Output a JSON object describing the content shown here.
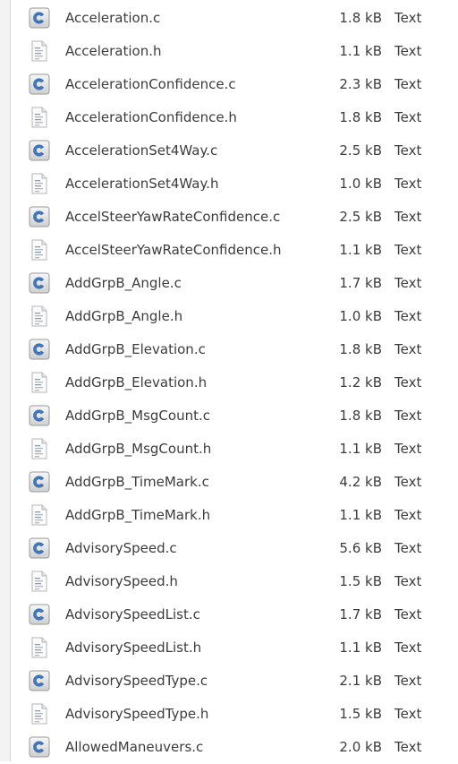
{
  "icons": {
    "c_source": "c-source-file-icon",
    "c_header": "c-header-file-icon"
  },
  "colors": {
    "text": "#3c3c3c",
    "c_icon_blue": "#3f7cc4",
    "header_icon_line": "#7da0c8"
  },
  "files": [
    {
      "name": "Acceleration.c",
      "size": "1.8 kB",
      "type": "Text",
      "kind": "c"
    },
    {
      "name": "Acceleration.h",
      "size": "1.1 kB",
      "type": "Text",
      "kind": "h"
    },
    {
      "name": "AccelerationConfidence.c",
      "size": "2.3 kB",
      "type": "Text",
      "kind": "c"
    },
    {
      "name": "AccelerationConfidence.h",
      "size": "1.8 kB",
      "type": "Text",
      "kind": "h"
    },
    {
      "name": "AccelerationSet4Way.c",
      "size": "2.5 kB",
      "type": "Text",
      "kind": "c"
    },
    {
      "name": "AccelerationSet4Way.h",
      "size": "1.0 kB",
      "type": "Text",
      "kind": "h"
    },
    {
      "name": "AccelSteerYawRateConfidence.c",
      "size": "2.5 kB",
      "type": "Text",
      "kind": "c"
    },
    {
      "name": "AccelSteerYawRateConfidence.h",
      "size": "1.1 kB",
      "type": "Text",
      "kind": "h"
    },
    {
      "name": "AddGrpB_Angle.c",
      "size": "1.7 kB",
      "type": "Text",
      "kind": "c"
    },
    {
      "name": "AddGrpB_Angle.h",
      "size": "1.0 kB",
      "type": "Text",
      "kind": "h"
    },
    {
      "name": "AddGrpB_Elevation.c",
      "size": "1.8 kB",
      "type": "Text",
      "kind": "c"
    },
    {
      "name": "AddGrpB_Elevation.h",
      "size": "1.2 kB",
      "type": "Text",
      "kind": "h"
    },
    {
      "name": "AddGrpB_MsgCount.c",
      "size": "1.8 kB",
      "type": "Text",
      "kind": "c"
    },
    {
      "name": "AddGrpB_MsgCount.h",
      "size": "1.1 kB",
      "type": "Text",
      "kind": "h"
    },
    {
      "name": "AddGrpB_TimeMark.c",
      "size": "4.2 kB",
      "type": "Text",
      "kind": "c"
    },
    {
      "name": "AddGrpB_TimeMark.h",
      "size": "1.1 kB",
      "type": "Text",
      "kind": "h"
    },
    {
      "name": "AdvisorySpeed.c",
      "size": "5.6 kB",
      "type": "Text",
      "kind": "c"
    },
    {
      "name": "AdvisorySpeed.h",
      "size": "1.5 kB",
      "type": "Text",
      "kind": "h"
    },
    {
      "name": "AdvisorySpeedList.c",
      "size": "1.7 kB",
      "type": "Text",
      "kind": "c"
    },
    {
      "name": "AdvisorySpeedList.h",
      "size": "1.1 kB",
      "type": "Text",
      "kind": "h"
    },
    {
      "name": "AdvisorySpeedType.c",
      "size": "2.1 kB",
      "type": "Text",
      "kind": "c"
    },
    {
      "name": "AdvisorySpeedType.h",
      "size": "1.5 kB",
      "type": "Text",
      "kind": "h"
    },
    {
      "name": "AllowedManeuvers.c",
      "size": "2.0 kB",
      "type": "Text",
      "kind": "c"
    }
  ]
}
